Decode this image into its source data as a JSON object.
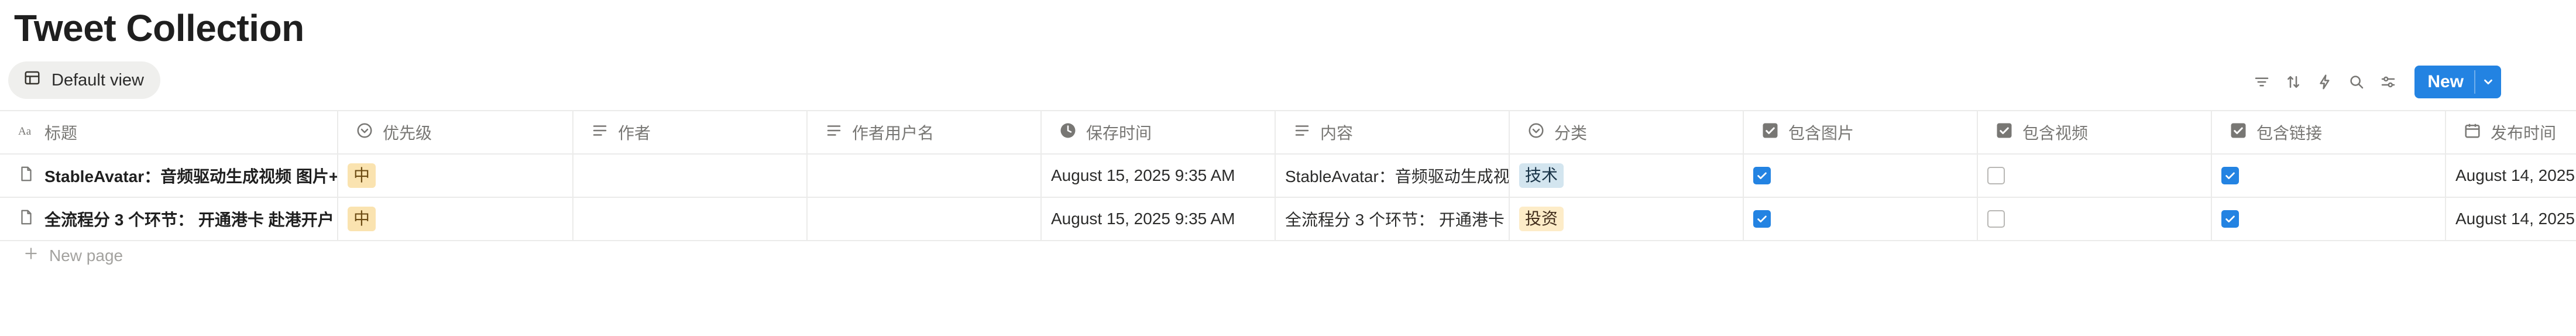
{
  "page": {
    "title": "Tweet Collection"
  },
  "view": {
    "label": "Default view"
  },
  "toolbar": {
    "icons": [
      "filter-icon",
      "sort-icon",
      "automation-icon",
      "search-icon",
      "settings-icon"
    ],
    "new_label": "New"
  },
  "columns": [
    {
      "label": "标题",
      "icon": "text-type-icon"
    },
    {
      "label": "优先级",
      "icon": "select-icon"
    },
    {
      "label": "作者",
      "icon": "text-lines-icon"
    },
    {
      "label": "作者用户名",
      "icon": "text-lines-icon"
    },
    {
      "label": "保存时间",
      "icon": "clock-icon"
    },
    {
      "label": "内容",
      "icon": "text-lines-icon"
    },
    {
      "label": "分类",
      "icon": "select-icon"
    },
    {
      "label": "包含图片",
      "icon": "checkbox-icon"
    },
    {
      "label": "包含视频",
      "icon": "checkbox-icon"
    },
    {
      "label": "包含链接",
      "icon": "checkbox-icon"
    },
    {
      "label": "发布时间",
      "icon": "calendar-icon"
    }
  ],
  "rows": [
    {
      "title": "StableAvatar：音频驱动生成视频 图片+",
      "priority": "中",
      "author": "",
      "username": "",
      "saved_time": "August 15, 2025 9:35 AM",
      "content": "StableAvatar：音频驱动生成视",
      "category": "技术",
      "has_image": true,
      "has_video": false,
      "has_link": true,
      "published_time": "August 14, 2025"
    },
    {
      "title": "全流程分 3 个环节： 开通港卡 赴港开户",
      "priority": "中",
      "author": "",
      "username": "",
      "saved_time": "August 15, 2025 9:35 AM",
      "content": "全流程分 3 个环节： 开通港卡",
      "category": "投资",
      "has_image": true,
      "has_video": false,
      "has_link": true,
      "published_time": "August 14, 2025"
    }
  ],
  "new_page_label": "New page",
  "colors": {
    "accent": "#2383e2",
    "tag_priority": "#fae3b0",
    "tag_tech": "#d3e5ef",
    "tag_invest": "#fdecc8"
  }
}
